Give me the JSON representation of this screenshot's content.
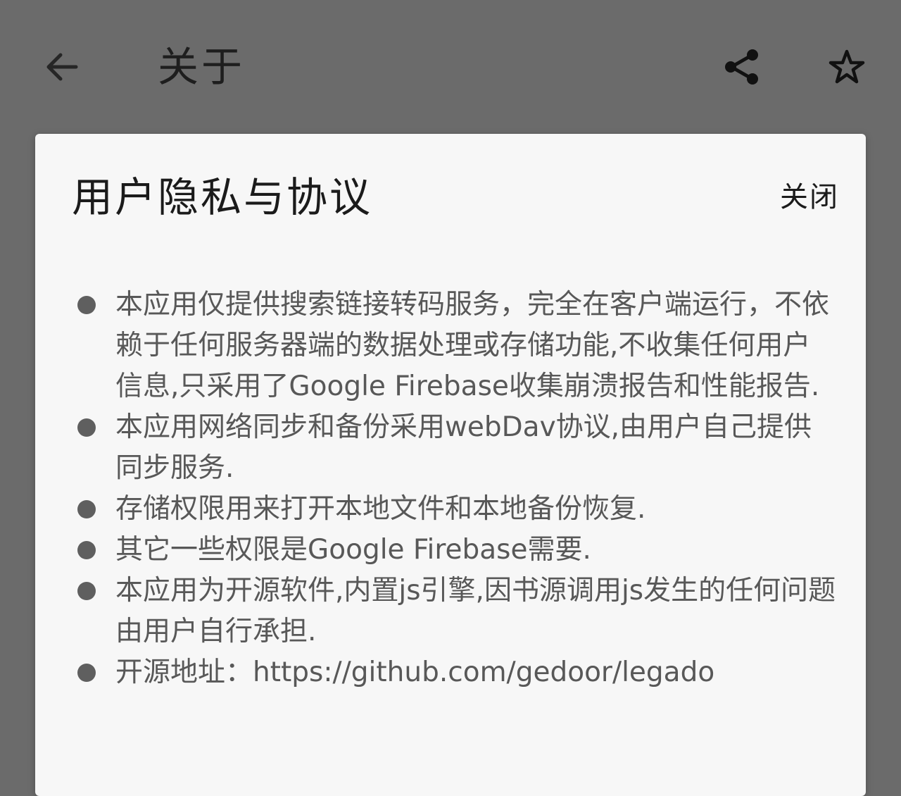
{
  "toolbar": {
    "title": "关于",
    "back_icon": "arrow-left-icon",
    "share_icon": "share-icon",
    "star_icon": "star-outline-icon"
  },
  "dialog": {
    "title": "用户隐私与协议",
    "close_label": "关闭",
    "items": [
      "本应用仅提供搜索链接转码服务，完全在客户端运行，不依赖于任何服务器端的数据处理或存储功能,不收集任何用户信息,只采用了Google Firebase收集崩溃报告和性能报告.",
      "本应用网络同步和备份采用webDav协议,由用户自己提供同步服务.",
      "存储权限用来打开本地文件和本地备份恢复.",
      "其它一些权限是Google Firebase需要.",
      "本应用为开源软件,内置js引擎,因书源调用js发生的任何问题由用户自行承担.",
      "开源地址：https://github.com/gedoor/legado"
    ]
  },
  "colors": {
    "scrim": "#6b6b6b",
    "dialog_bg": "#f7f7f7",
    "title_text": "#1b1b1b",
    "body_text": "#585858"
  }
}
